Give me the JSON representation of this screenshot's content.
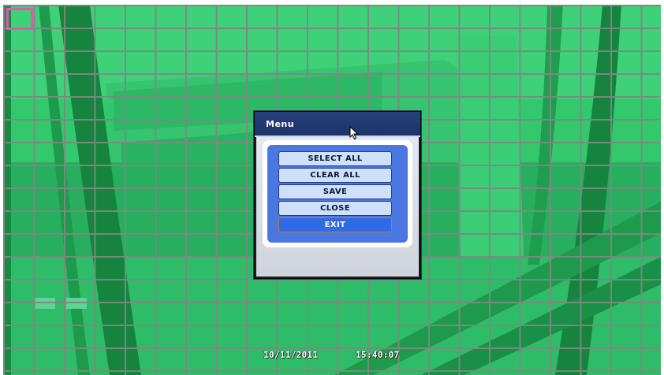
{
  "menu": {
    "title": "Menu",
    "buttons": [
      {
        "label": "SELECT ALL",
        "active": false
      },
      {
        "label": "CLEAR ALL",
        "active": false
      },
      {
        "label": "SAVE",
        "active": false
      },
      {
        "label": "CLOSE",
        "active": false
      },
      {
        "label": "EXIT",
        "active": true
      }
    ]
  },
  "osd": {
    "date": "10/11/2011",
    "time": "15:40:07"
  },
  "colors": {
    "overlay_green": "#2fc66a",
    "grid_line": "#7c8a80",
    "selected_cell_border": "#e05bb0",
    "menu_accent": "#4a78e0"
  }
}
